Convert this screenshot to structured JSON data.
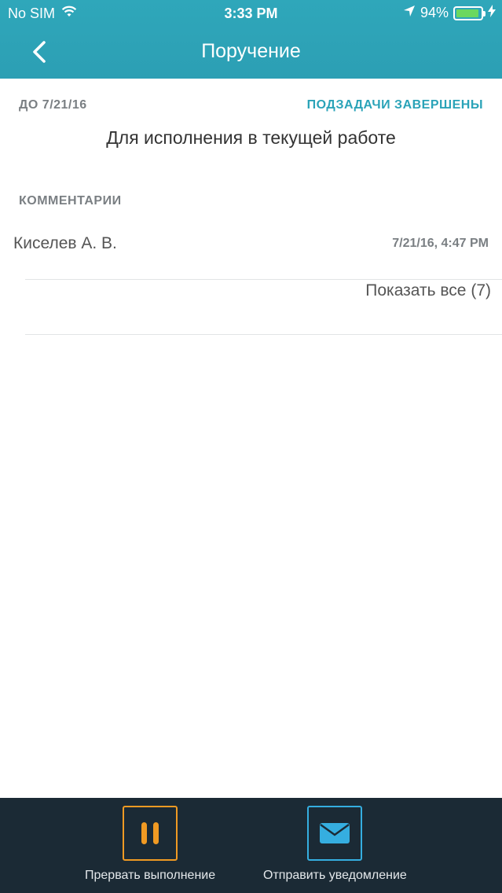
{
  "status_bar": {
    "carrier": "No SIM",
    "time": "3:33 PM",
    "battery_percent": "94%",
    "battery_level": 0.94,
    "icons": [
      "wifi-icon",
      "location-arrow-icon",
      "battery-icon",
      "charging-bolt-icon"
    ]
  },
  "nav": {
    "title": "Поручение",
    "back_icon": "chevron-left-icon"
  },
  "task": {
    "due_label": "ДО 7/21/16",
    "subtasks_status": "ПОДЗАДАЧИ ЗАВЕРШЕНЫ",
    "description": "Для исполнения в текущей работе"
  },
  "comments": {
    "section_label": "КОММЕНТАРИИ",
    "items": [
      {
        "author": "Киселев А. В.",
        "date": "7/21/16, 4:47 PM"
      }
    ],
    "show_all_label": "Показать все (7)"
  },
  "toolbar": {
    "pause_label": "Прервать выполнение",
    "pause_icon": "pause-icon",
    "notify_label": "Отправить уведомление",
    "notify_icon": "envelope-icon"
  },
  "colors": {
    "header": "#2fa7ba",
    "accent": "#2aa3b8",
    "toolbar_bg": "#1b2a35",
    "pause": "#f09a23",
    "notify": "#35aee0"
  }
}
